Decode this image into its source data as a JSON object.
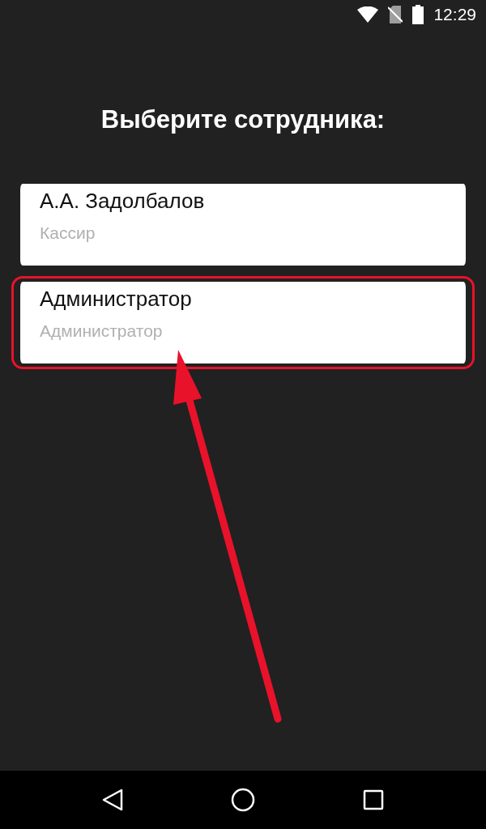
{
  "status_bar": {
    "time": "12:29"
  },
  "title": "Выберите сотрудника:",
  "employees": [
    {
      "name": "А.А. Задолбалов",
      "role": "Кассир",
      "highlighted": false
    },
    {
      "name": "Администратор",
      "role": "Администратор",
      "highlighted": true
    }
  ]
}
